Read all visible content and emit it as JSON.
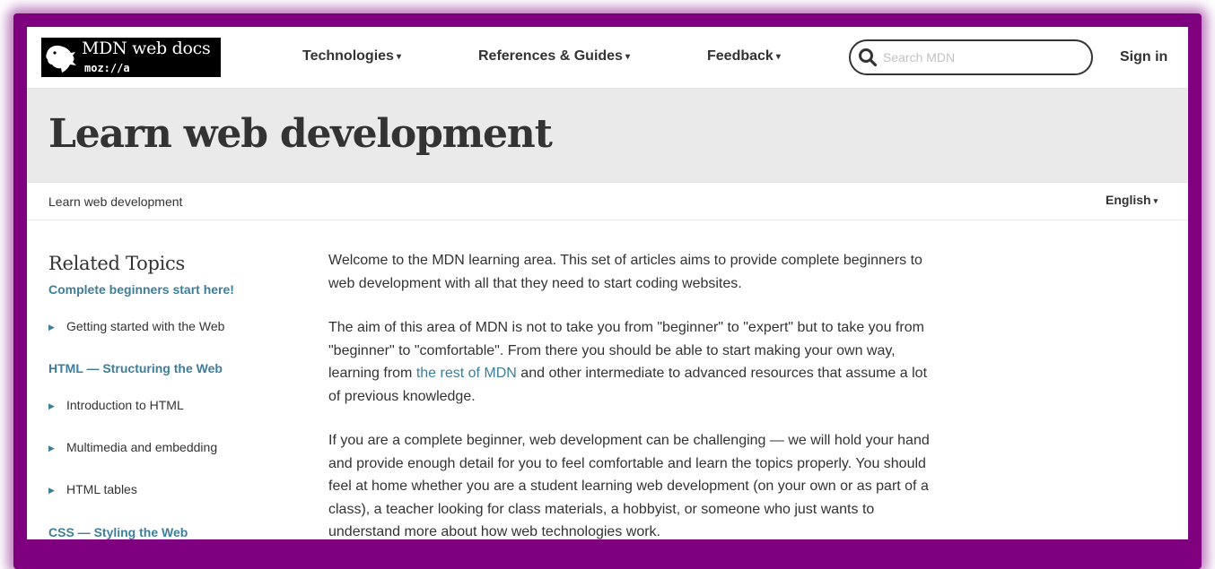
{
  "header": {
    "logo": {
      "wordmark": "MDN web docs",
      "mozilla": "moz://a"
    },
    "nav": [
      {
        "label": "Technologies",
        "caret": "▾"
      },
      {
        "label": "References & Guides",
        "caret": "▾"
      },
      {
        "label": "Feedback",
        "caret": "▾"
      }
    ],
    "search": {
      "placeholder": "Search MDN",
      "value": ""
    },
    "sign_in": "Sign in"
  },
  "page_title": "Learn web development",
  "breadcrumb": "Learn web development",
  "language": {
    "label": "English",
    "caret": "▾"
  },
  "sidebar": {
    "heading": "Related Topics",
    "sections": [
      {
        "title": "Complete beginners start here!",
        "items": [
          "Getting started with the Web"
        ]
      },
      {
        "title": "HTML — Structuring the Web",
        "items": [
          "Introduction to HTML",
          "Multimedia and embedding",
          "HTML tables"
        ]
      },
      {
        "title": "CSS — Styling the Web",
        "items": []
      }
    ],
    "arrow": "▶"
  },
  "main": {
    "p1": "Welcome to the MDN learning area. This set of articles aims to provide complete beginners to web development with all that they need to start coding websites.",
    "p2_before": "The aim of this area of MDN is not to take you from \"beginner\" to \"expert\" but to take you from \"beginner\" to \"comfortable\". From there you should be able to start making your own way, learning from ",
    "p2_link": "the rest of MDN",
    "p2_after": " and other intermediate to advanced resources that assume a lot of previous knowledge.",
    "p3": "If you are a complete beginner, web development can be challenging — we will hold your hand and provide enough detail for you to feel comfortable and learn the topics properly. You should feel at home whether you are a student learning web development (on your own or as part of a class), a teacher looking for class materials, a hobbyist, or someone who just wants to understand more about how web technologies work."
  },
  "colors": {
    "frame": "#7e007e",
    "link": "#3d7e9a",
    "title_band": "#eaeaea",
    "text": "#333333"
  },
  "icons": {
    "logo": "mdn-dinosaur-icon",
    "search": "search-icon",
    "caret": "caret-down-icon",
    "arrow": "triangle-right-icon"
  }
}
